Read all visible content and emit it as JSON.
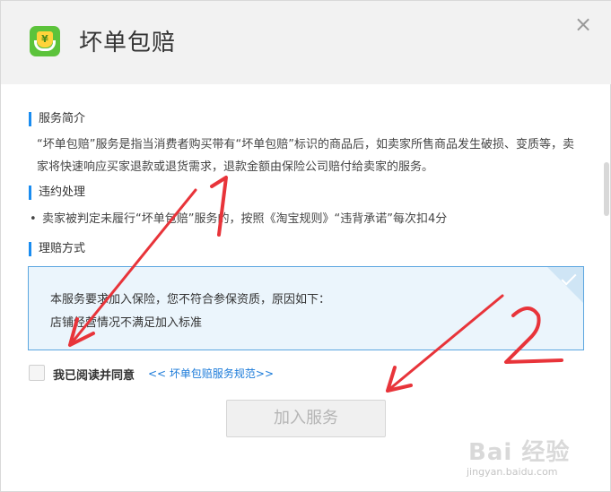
{
  "dialog": {
    "title": "坏单包赔",
    "logo_icon": "compensation-logo-icon",
    "close_icon": "close-icon",
    "close_glyph": "×"
  },
  "sections": {
    "intro_title": "服务简介",
    "intro_text": "“坏单包赔”服务是指当消费者购买带有“坏单包赔”标识的商品后，如卖家所售商品发生破损、变质等，卖家将快速响应买家退款或退货需求，退款金额由保险公司赔付给卖家的服务。",
    "violation_title": "违约处理",
    "violation_item": "卖家被判定未履行“坏单包赔”服务的，按照《淘宝规则》“违背承诺”每次扣4分",
    "claim_title": "理赔方式"
  },
  "notice": {
    "line1": "本服务要求加入保险，您不符合参保资质，原因如下：",
    "line2": "店铺经营情况不满足加入标准"
  },
  "agreement": {
    "label": "我已阅读并同意",
    "link": "<< 坏单包赔服务规范>>"
  },
  "actions": {
    "join_label": "加入服务"
  },
  "annotations": {
    "mark1": "1",
    "mark2": "2",
    "color": "#e8343a"
  },
  "watermark": {
    "brand": "Bai 经验",
    "url": "jingyan.baidu.com"
  },
  "colors": {
    "accent": "#1a8cf0",
    "link": "#1a7ad9",
    "logo": "#5cc33b",
    "notice_bg": "#ebf5fc"
  }
}
